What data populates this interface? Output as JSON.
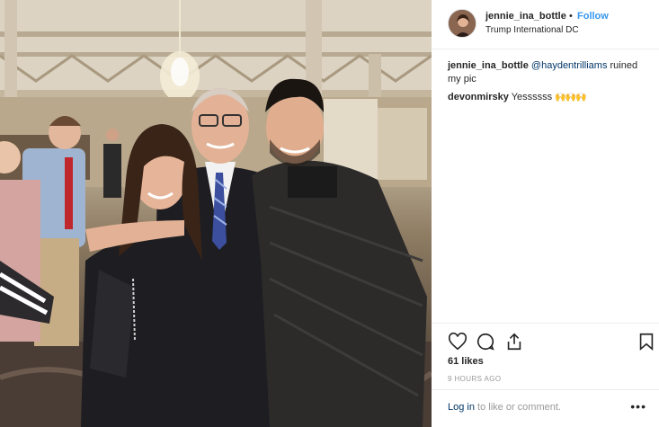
{
  "post": {
    "photo_alt": "",
    "header": {
      "username": "jennie_ina_bottle",
      "separator": "•",
      "follow_label": "Follow",
      "location": "Trump International DC"
    },
    "comments": [
      {
        "user": "jennie_ina_bottle",
        "mention": "@haydentrilliams",
        "text": " ruined my pic"
      },
      {
        "user": "devonmirsky",
        "text": " Yessssss",
        "emoji": "🙌🙌🙌"
      }
    ],
    "actions": {
      "like_icon": "heart-icon",
      "comment_icon": "comment-bubble-icon",
      "share_icon": "share-icon",
      "save_icon": "bookmark-icon"
    },
    "likes_text": "61 likes",
    "timestamp": "9 HOURS AGO",
    "login_link": "Log in",
    "login_suffix": " to like or comment.",
    "more_label": "•••",
    "colors": {
      "link_blue": "#3897f0",
      "mention": "#003569",
      "text": "#262626",
      "muted": "#999999",
      "divider": "#efefef"
    }
  }
}
